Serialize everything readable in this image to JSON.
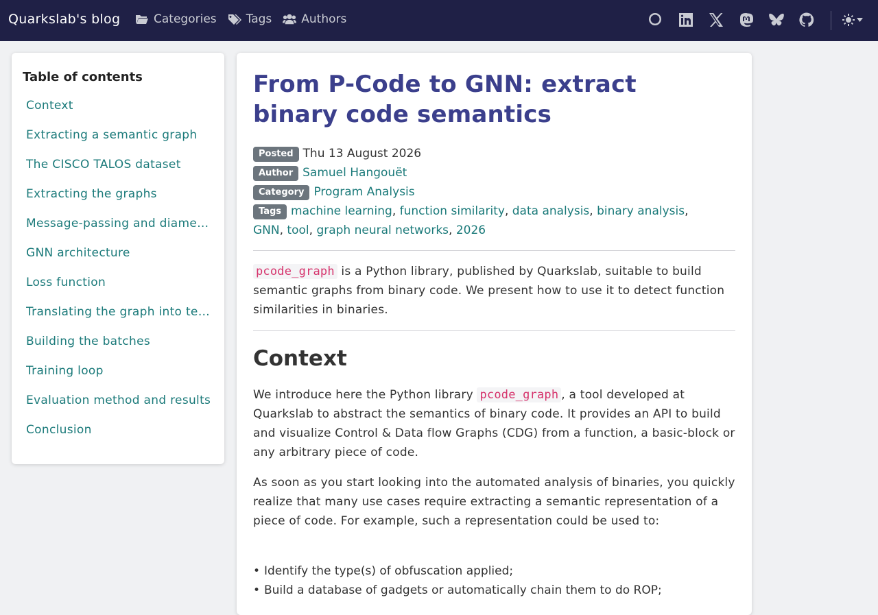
{
  "nav": {
    "brand": "Quarkslab's blog",
    "links": [
      {
        "label": "Categories",
        "icon": "folder-open-icon"
      },
      {
        "label": "Tags",
        "icon": "tags-icon"
      },
      {
        "label": "Authors",
        "icon": "users-icon"
      }
    ],
    "icons": [
      "search-icon",
      "linkedin-icon",
      "x-twitter-icon",
      "mastodon-icon",
      "bluesky-icon",
      "github-icon"
    ],
    "theme_icon": "sun-icon"
  },
  "toc": {
    "title": "Table of contents",
    "items": [
      "Context",
      "Extracting a semantic graph",
      "The CISCO TALOS dataset",
      "Extracting the graphs",
      "Message-passing and diameter",
      "GNN architecture",
      "Loss function",
      "Translating the graph into tensors",
      "Building the batches",
      "Training loop",
      "Evaluation method and results",
      "Conclusion"
    ]
  },
  "article": {
    "title": "From P-Code to GNN: extract binary code semantics",
    "posted_label": "Posted",
    "posted_date": "Thu 13 August 2026",
    "author_label": "Author",
    "author": "Samuel Hangouët",
    "category_label": "Category",
    "category": "Program Analysis",
    "tags_label": "Tags",
    "tags": [
      "machine learning",
      "function similarity",
      "data analysis",
      "binary analysis",
      "GNN",
      "tool",
      "graph neural networks",
      "2026"
    ],
    "intro_code": "pcode_graph",
    "intro_text_1": " is a Python library, published by Quarkslab, suitable to build semantic graphs from binary code. We present how to use it to detect function similarities in binaries.",
    "context_heading": "Context",
    "p1_before": "We introduce here the Python library ",
    "p1_code": "pcode_graph",
    "p1_after": ", a tool developed at Quarkslab to abstract the semantics of binary code. It provides an API to build and visualize Control & Data flow Graphs (CDG) from a function, a basic-block or any arbitrary piece of code.",
    "p2": "As soon as you start looking into the automated analysis of binaries, you quickly realize that many use cases require extracting a semantic representation of a piece of code. For example, such a representation could be used to:",
    "bullets": [
      "Identify the type(s) of obfuscation applied;",
      "Build a database of gadgets or automatically chain them to do ROP;"
    ]
  }
}
